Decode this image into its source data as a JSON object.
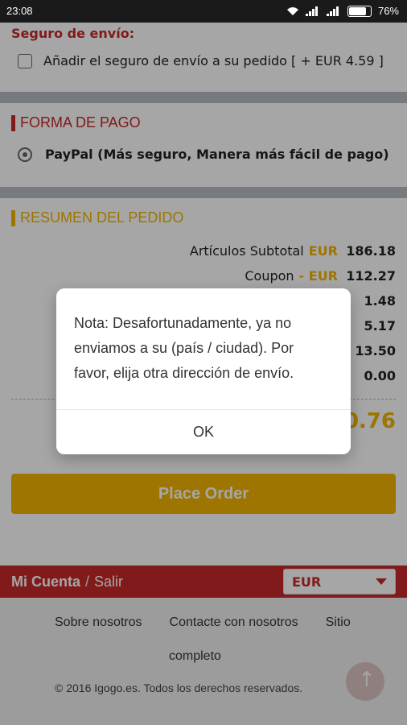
{
  "status_bar": {
    "time": "23:08",
    "battery_text": "76%",
    "icons": [
      "wifi-icon",
      "signal-icon",
      "signal-icon",
      "battery-icon"
    ]
  },
  "shipping_insurance": {
    "title": "Seguro de envío:",
    "checkbox_label": "Añadir el seguro de envío a su pedido [ + EUR   4.59 ]"
  },
  "payment": {
    "title": "FORMA DE PAGO",
    "method_label": "PayPal  (Más seguro, Manera más fácil de pago)"
  },
  "summary": {
    "title": "RESUMEN DEL PEDIDO",
    "rows": [
      {
        "label": "Artículos Subtotal",
        "currency": "EUR",
        "value": "186.18"
      },
      {
        "label": "Coupon",
        "currency": "- EUR",
        "value": "112.27"
      },
      {
        "label": "",
        "currency": "R",
        "value": "1.48"
      },
      {
        "label": "",
        "currency": "UR",
        "value": "5.17"
      },
      {
        "label": "",
        "currency": "",
        "value": "13.50"
      },
      {
        "label": "",
        "currency": "R",
        "value": "0.00"
      }
    ],
    "total_partial": "0.76"
  },
  "buttons": {
    "place_order": "Place Order",
    "ok": "OK"
  },
  "footer": {
    "account": "Mi Cuenta",
    "separator": "/",
    "logout": "Salir",
    "currency_selected": "EUR",
    "links": [
      "Sobre nosotros",
      "Contacte con nosotros",
      "Sitio",
      "completo"
    ],
    "copyright": "© 2016 Igogo.es. Todos los derechos reservados."
  },
  "modal": {
    "message": "Nota: Desafortunadamente, ya no enviamos a su (país / ciudad). Por favor, elija otra dirección de envío."
  },
  "colors": {
    "accent_red": "#c62828",
    "accent_gold": "#f2b400"
  }
}
